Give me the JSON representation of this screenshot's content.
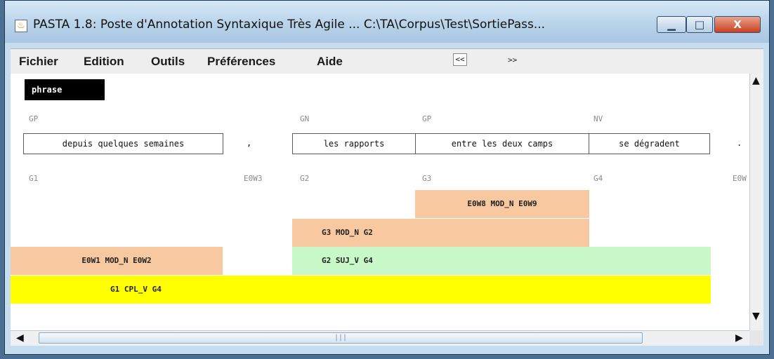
{
  "window": {
    "title": "PASTA 1.8: Poste d'Annotation Syntaxique Très Agile ... C:\\TA\\Corpus\\Test\\SortiePass...",
    "controls": {
      "minimize": "▁",
      "maximize": "□",
      "close": "X"
    }
  },
  "menu": {
    "items": [
      "Fichier",
      "Edition",
      "Outils",
      "Préférences",
      "Aide"
    ],
    "prev_label": "<<",
    "next_label": ">>"
  },
  "sentence": {
    "tag": "phrase",
    "chunk_types": [
      "GP",
      "GN",
      "GP",
      "NV"
    ],
    "chunks": [
      "depuis quelques semaines",
      "les rapports",
      "entre les deux camps",
      "se dégradent"
    ],
    "punctuation": [
      ",",
      "."
    ],
    "group_ids": [
      "G1",
      "E0W3",
      "G2",
      "G3",
      "G4",
      "E0W"
    ]
  },
  "relations": [
    {
      "label": "E0W8 MOD_N E0W9",
      "type": "MOD_N"
    },
    {
      "label": "G3 MOD_N G2",
      "type": "MOD_N"
    },
    {
      "label": "E0W1 MOD_N E0W2",
      "type": "MOD_N"
    },
    {
      "label": "G2 SUJ_V G4",
      "type": "SUJ_V"
    },
    {
      "label": "G1 CPL_V G4",
      "type": "CPL_V"
    }
  ],
  "scrollbars": {
    "up_arrow": "▲",
    "down_arrow": "▼",
    "left_arrow": "◀",
    "right_arrow": "▶",
    "thumb_grip": "|||"
  },
  "colors": {
    "mod_n": "#f8c8a0",
    "suj_v": "#c9f8c9",
    "cpl_v": "#ffff00",
    "phrase_tag_bg": "#000000"
  }
}
